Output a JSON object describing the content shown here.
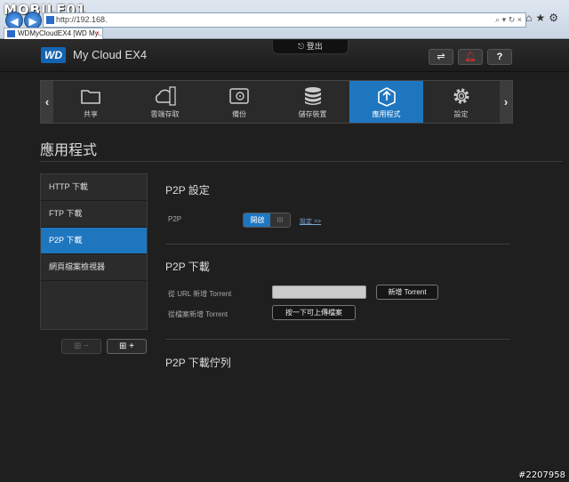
{
  "browser": {
    "watermark_logo": "MOBILE01",
    "address": "http://192.168.",
    "tab_title": "WDMyCloudEX4 [WD My..."
  },
  "header": {
    "brand": "WD",
    "product": "My Cloud EX4",
    "logout_label": "登出",
    "usb_icon": "usb-icon",
    "alert_icon": "bell-alert-icon",
    "help_label": "?"
  },
  "nav": {
    "items": [
      {
        "label": "共享",
        "icon": "folder-icon"
      },
      {
        "label": "雲端存取",
        "icon": "cloud-phone-icon"
      },
      {
        "label": "備份",
        "icon": "safe-icon"
      },
      {
        "label": "儲存裝置",
        "icon": "database-icon"
      },
      {
        "label": "應用程式",
        "icon": "apps-box-icon"
      },
      {
        "label": "設定",
        "icon": "gear-icon"
      }
    ],
    "active": "應用程式"
  },
  "page_title": "應用程式",
  "sidebar": {
    "items": [
      {
        "label": "HTTP 下載"
      },
      {
        "label": "FTP 下載"
      },
      {
        "label": "P2P 下載"
      },
      {
        "label": "網頁檔案檢視器"
      }
    ],
    "remove_label": "−",
    "add_label": "+"
  },
  "content": {
    "p2p_settings_title": "P2P 設定",
    "p2p_label": "P2P",
    "toggle_on": "開啟",
    "toggle_knob": "III",
    "settings_link": "設定 >>",
    "download_title": "P2P 下載",
    "url_label": "從 URL 新增 Torrent",
    "url_value": "",
    "add_torrent_label": "新增 Torrent",
    "file_label": "從檔案新增 Torrent",
    "upload_label": "按一下可上傳檔案",
    "queue_title": "P2P 下載佇列"
  },
  "watermark_id": "#2207958"
}
